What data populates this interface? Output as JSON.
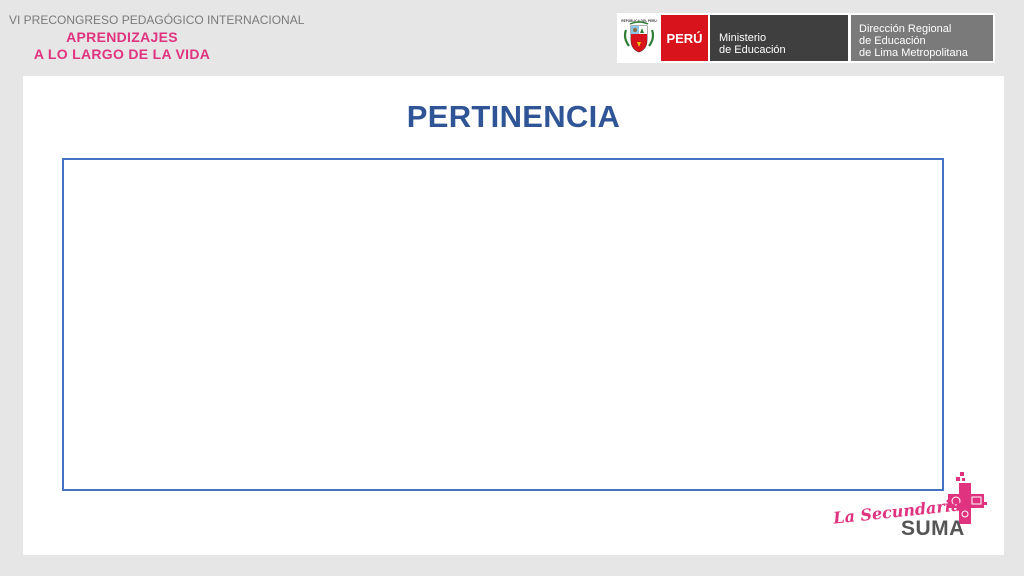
{
  "event": {
    "supertitle": "VI PRECONGRESO PEDAGÓGICO INTERNACIONAL",
    "line1": "APRENDIZAJES",
    "line2": "A LO LARGO DE LA VIDA"
  },
  "gov": {
    "country": "PERÚ",
    "ministry_line1": "Ministerio",
    "ministry_line2": "de Educación",
    "dre_line1": "Dirección Regional",
    "dre_line2": "de Educación",
    "dre_line3": "de Lima Metropolitana",
    "shield_text": "REPÚBLICA DEL PERÚ"
  },
  "slide": {
    "title": "PERTINENCIA"
  },
  "brand": {
    "line1": "La Secundaria",
    "line2": "SUMA"
  },
  "colors": {
    "accent_pink": "#e0337f",
    "title_blue": "#2f5597",
    "box_border": "#4472c4",
    "peru_red": "#d8131c"
  }
}
